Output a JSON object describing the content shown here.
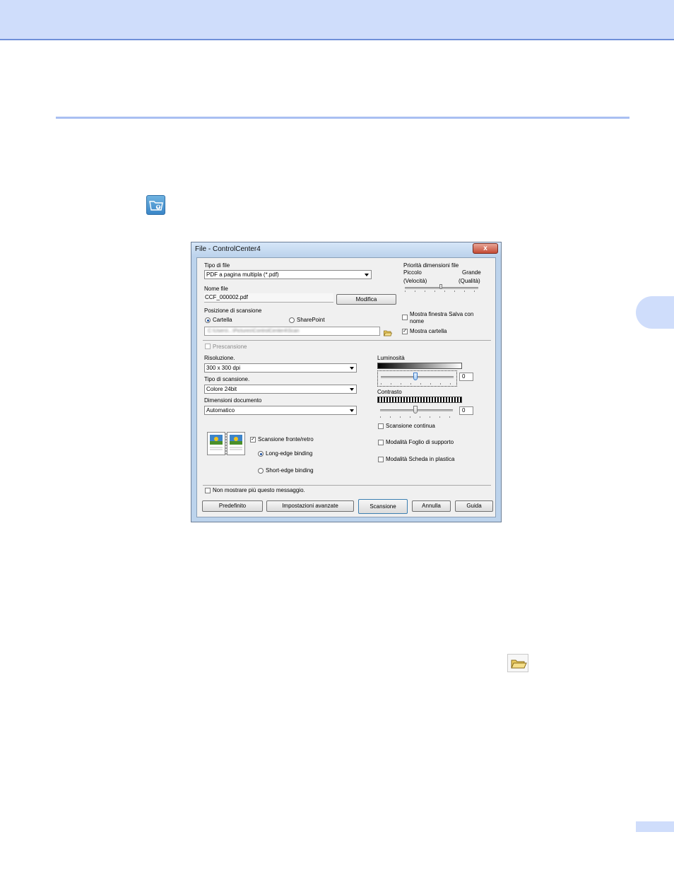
{
  "dialog": {
    "title": "File - ControlCenter4",
    "close_label": "x",
    "file_type": {
      "label": "Tipo di file",
      "value": "PDF a pagina multipla (*.pdf)"
    },
    "file_size_priority": {
      "label": "Priorità dimensioni file",
      "small": "Piccolo",
      "small_sub": "(Velocità)",
      "large": "Grande",
      "large_sub": "(Qualità)"
    },
    "file_name": {
      "label": "Nome file",
      "value": "CCF_000002.pdf",
      "modify_button": "Modifica"
    },
    "scan_location": {
      "label": "Posizione di scansione",
      "option_folder": "Cartella",
      "option_sharepoint": "SharePoint",
      "selected": "Cartella",
      "path": "C:\\Users\\...\\Pictures\\ControlCenter4\\Scan"
    },
    "show_save_as": {
      "label": "Mostra finestra Salva con nome",
      "checked": false
    },
    "show_folder": {
      "label": "Mostra cartella",
      "checked": true
    },
    "prescan": {
      "label": "Prescansione",
      "checked": false
    },
    "resolution": {
      "label": "Risoluzione.",
      "value": "300 x 300 dpi"
    },
    "scan_type": {
      "label": "Tipo di scansione.",
      "value": "Colore 24bit"
    },
    "document_size": {
      "label": "Dimensioni documento",
      "value": "Automatico"
    },
    "brightness": {
      "label": "Luminosità",
      "value": "0"
    },
    "contrast": {
      "label": "Contrasto",
      "value": "0"
    },
    "continuous_scan": {
      "label": "Scansione continua",
      "checked": false
    },
    "duplex": {
      "label": "Scansione fronte/retro",
      "checked": true,
      "long_edge": "Long-edge binding",
      "short_edge": "Short-edge binding",
      "selected": "Long-edge binding"
    },
    "carrier_sheet": {
      "label": "Modalità Foglio di supporto",
      "checked": false
    },
    "plastic_card": {
      "label": "Modalità Scheda in plastica",
      "checked": false
    },
    "dont_show_again": {
      "label": "Non mostrare più questo messaggio.",
      "checked": false
    },
    "buttons": {
      "default": "Predefinito",
      "advanced": "Impostazioni avanzate",
      "scan": "Scansione",
      "cancel": "Annulla",
      "help": "Guida"
    }
  },
  "colors": {
    "header_band": "#cfddfb",
    "rule": "#a9bff2",
    "dialog_frame": "#bcd3ec"
  },
  "icons": {
    "app_icon": "folder-upload-icon",
    "browse_icon": "folder-icon"
  }
}
